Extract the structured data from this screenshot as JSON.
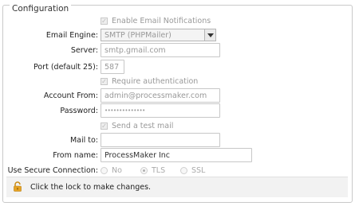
{
  "section_title": "Configuration",
  "enable_notifications": {
    "label": "Enable Email Notifications",
    "checked": true
  },
  "email_engine": {
    "label": "Email Engine:",
    "value": "SMTP (PHPMailer)"
  },
  "server": {
    "label": "Server:",
    "value": "smtp.gmail.com"
  },
  "port": {
    "label": "Port (default 25):",
    "value": "587"
  },
  "require_auth": {
    "label": "Require authentication",
    "checked": true
  },
  "account_from": {
    "label": "Account From:",
    "value": "admin@processmaker.com"
  },
  "password": {
    "label": "Password:",
    "value": "••••••••••••••"
  },
  "send_test_mail": {
    "label": "Send a test mail",
    "checked": true
  },
  "mail_to": {
    "label": "Mail to:",
    "value": ""
  },
  "from_name": {
    "label": "From name:",
    "value": "ProcessMaker Inc"
  },
  "secure_connection": {
    "label": "Use Secure Connection:",
    "options": [
      "No",
      "TLS",
      "SSL"
    ],
    "selected": "TLS"
  },
  "lock_message": "Click the lock to make changes.",
  "colors": {
    "lock": "#e6a323"
  }
}
